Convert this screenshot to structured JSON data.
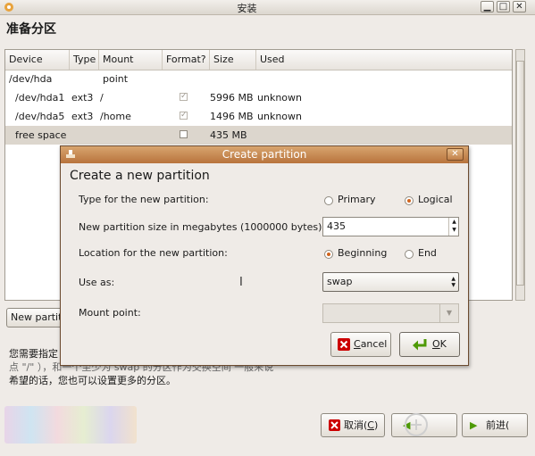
{
  "window": {
    "title": "安装",
    "minimize_glyph": "▁",
    "maximize_glyph": "□",
    "close_glyph": "✕"
  },
  "page_heading": "准备分区",
  "table": {
    "columns": [
      "Device",
      "Type",
      "Mount point",
      "Format?",
      "Size",
      "Used"
    ],
    "rows": [
      {
        "device": "/dev/hda",
        "type": "",
        "mount": "",
        "format": "none",
        "size": "",
        "used": ""
      },
      {
        "device": "/dev/hda1",
        "type": "ext3",
        "mount": "/",
        "format": "checked",
        "size": "5996 MB",
        "used": "unknown"
      },
      {
        "device": "/dev/hda5",
        "type": "ext3",
        "mount": "/home",
        "format": "checked",
        "size": "1496 MB",
        "used": "unknown"
      },
      {
        "device": "free space",
        "type": "",
        "mount": "",
        "format": "unchecked",
        "size": "435 MB",
        "used": ""
      }
    ]
  },
  "new_partition_button": "New partiti",
  "info_text": {
    "line1": "您需要指定",
    "line2": "点 \"/\" ），和一个至少为 swap 的分区作为交换空间 一般来说",
    "line3": "希望的话，您也可以设置更多的分区。"
  },
  "bottom_buttons": {
    "cancel": "取消(",
    "cancel_key": "C",
    "cancel_tail": ")",
    "forward": "前进("
  },
  "dialog": {
    "title": "Create partition",
    "heading": "Create a new partition",
    "type_label": "Type for the new partition:",
    "type_options": [
      "Primary",
      "Logical"
    ],
    "type_selected": "Logical",
    "size_label": "New partition size in megabytes (1000000 bytes):",
    "size_value": "435",
    "location_label": "Location for the new partition:",
    "location_options": [
      "Beginning",
      "End"
    ],
    "location_selected": "Beginning",
    "use_as_label": "Use as:",
    "use_as_value": "swap",
    "mount_label": "Mount point:",
    "mount_value": "",
    "cancel_label_first": "C",
    "cancel_label_rest": "ancel",
    "ok_label_first": "O",
    "ok_label_rest": "K"
  },
  "colors": {
    "dialog_titlebar": "#b8733c",
    "radio_selected": "#d0641e",
    "selected_row": "#dcd6cd",
    "ok_icon": "#4e9a06",
    "cancel_icon": "#cc0000"
  },
  "icons": {
    "app": "installer-icon",
    "cancel": "cancel-x-icon",
    "ok": "ok-return-arrow-icon",
    "spin": "spin-arrows-icon",
    "combo": "combo-arrows-icon",
    "cursor": "text-cursor-icon"
  }
}
